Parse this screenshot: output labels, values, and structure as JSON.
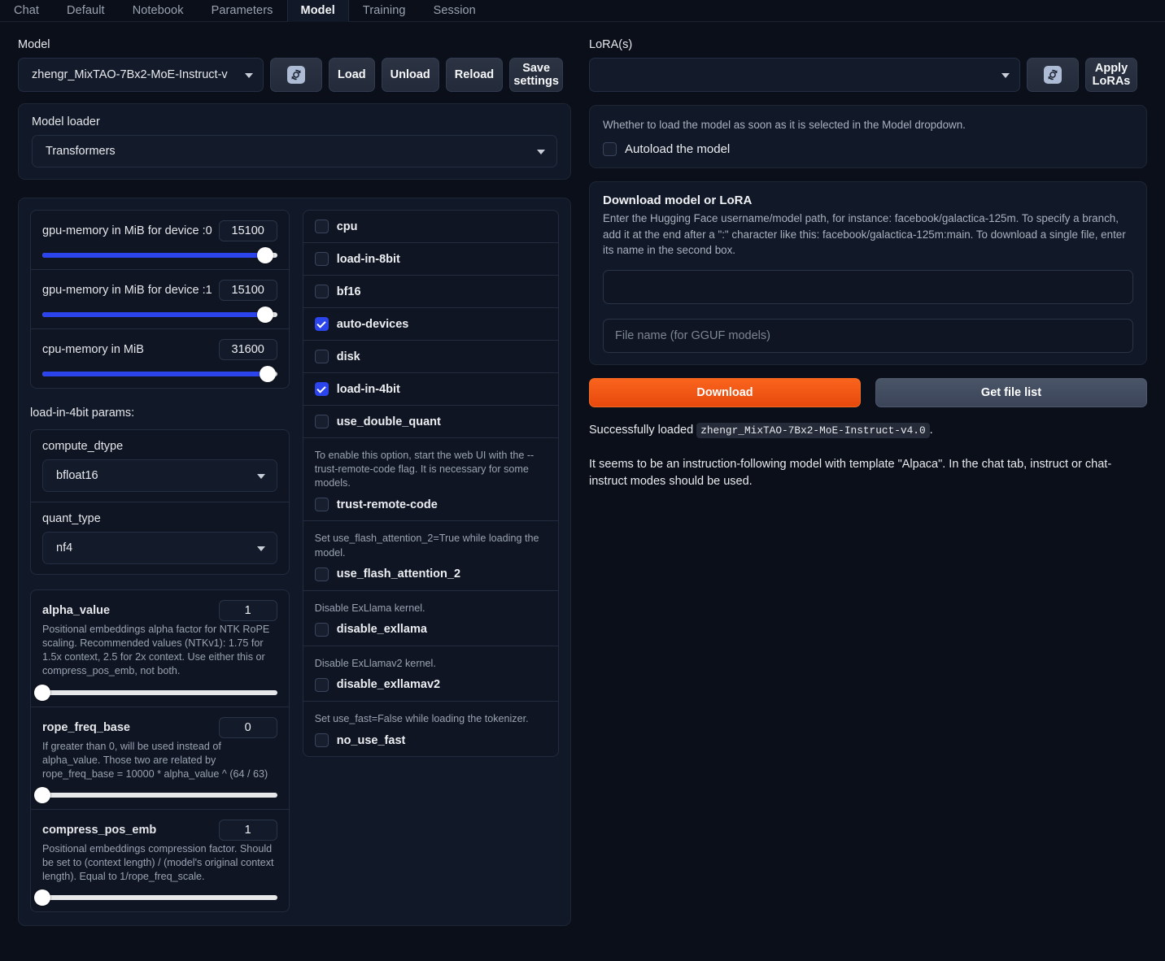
{
  "tabs": [
    {
      "label": "Chat",
      "active": false
    },
    {
      "label": "Default",
      "active": false
    },
    {
      "label": "Notebook",
      "active": false
    },
    {
      "label": "Parameters",
      "active": false
    },
    {
      "label": "Model",
      "active": true
    },
    {
      "label": "Training",
      "active": false
    },
    {
      "label": "Session",
      "active": false
    }
  ],
  "left": {
    "model_label": "Model",
    "model_dropdown_value": "zhengr_MixTAO-7Bx2-MoE-Instruct-v",
    "refresh_icon": "refresh-icon",
    "buttons": {
      "load": "Load",
      "unload": "Unload",
      "reload": "Reload",
      "save_settings": "Save settings"
    },
    "model_loader": {
      "label": "Model loader",
      "value": "Transformers"
    },
    "sliders": [
      {
        "name": "gpu-memory in MiB for device :0",
        "value": "15100",
        "pct": 95
      },
      {
        "name": "gpu-memory in MiB for device :1",
        "value": "15100",
        "pct": 95
      },
      {
        "name": "cpu-memory in MiB",
        "value": "31600",
        "pct": 96
      }
    ],
    "params_heading": "load-in-4bit params:",
    "selects": [
      {
        "label": "compute_dtype",
        "value": "bfloat16"
      },
      {
        "label": "quant_type",
        "value": "nf4"
      }
    ],
    "rope_sliders": [
      {
        "name": "alpha_value",
        "value": "1",
        "pct": 0,
        "desc": "Positional embeddings alpha factor for NTK RoPE scaling. Recommended values (NTKv1): 1.75 for 1.5x context, 2.5 for 2x context. Use either this or compress_pos_emb, not both."
      },
      {
        "name": "rope_freq_base",
        "value": "0",
        "pct": 0,
        "desc": "If greater than 0, will be used instead of alpha_value. Those two are related by rope_freq_base = 10000 * alpha_value ^ (64 / 63)"
      },
      {
        "name": "compress_pos_emb",
        "value": "1",
        "pct": 0,
        "desc": "Positional embeddings compression factor. Should be set to (context length) / (model's original context length). Equal to 1/rope_freq_scale."
      }
    ],
    "checkboxes": [
      {
        "label": "cpu",
        "checked": false
      },
      {
        "label": "load-in-8bit",
        "checked": false
      },
      {
        "label": "bf16",
        "checked": false
      },
      {
        "label": "auto-devices",
        "checked": true
      },
      {
        "label": "disk",
        "checked": false
      },
      {
        "label": "load-in-4bit",
        "checked": true
      },
      {
        "label": "use_double_quant",
        "checked": false
      }
    ],
    "described_checkboxes": [
      {
        "desc": "To enable this option, start the web UI with the --trust-remote-code flag. It is necessary for some models.",
        "label": "trust-remote-code",
        "checked": false
      },
      {
        "desc": "Set use_flash_attention_2=True while loading the model.",
        "label": "use_flash_attention_2",
        "checked": false
      },
      {
        "desc": "Disable ExLlama kernel.",
        "label": "disable_exllama",
        "checked": false
      },
      {
        "desc": "Disable ExLlamav2 kernel.",
        "label": "disable_exllamav2",
        "checked": false
      },
      {
        "desc": "Set use_fast=False while loading the tokenizer.",
        "label": "no_use_fast",
        "checked": false
      }
    ]
  },
  "right": {
    "lora_label": "LoRA(s)",
    "lora_dropdown_value": "",
    "apply_loras": "Apply LoRAs",
    "autoload": {
      "desc": "Whether to load the model as soon as it is selected in the Model dropdown.",
      "label": "Autoload the model",
      "checked": false
    },
    "download": {
      "title": "Download model or LoRA",
      "desc": "Enter the Hugging Face username/model path, for instance: facebook/galactica-125m. To specify a branch, add it at the end after a \":\" character like this: facebook/galactica-125m:main. To download a single file, enter its name in the second box.",
      "repo_value": "",
      "repo_placeholder": "",
      "file_placeholder": "File name (for GGUF models)",
      "file_value": "",
      "download_button": "Download",
      "filelist_button": "Get file list"
    },
    "status": {
      "prefix": "Successfully loaded",
      "model_code": "zhengr_MixTAO-7Bx2-MoE-Instruct-v4.0",
      "suffix": ".",
      "second_line": "It seems to be an instruction-following model with template \"Alpaca\". In the chat tab, instruct or chat-instruct modes should be used."
    }
  },
  "colors": {
    "accent_blue": "#2b44ec",
    "download_orange": "#f05a1a",
    "background": "#0b0f19",
    "panel": "#111827"
  }
}
